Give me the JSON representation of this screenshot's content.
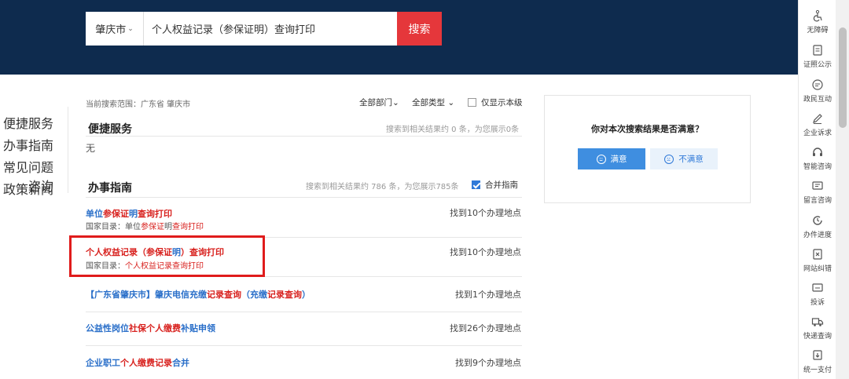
{
  "header": {
    "city": "肇庆市",
    "city_caret": "⌄",
    "search_value": "个人权益记录（参保证明）查询打印",
    "search_button": "搜索"
  },
  "left_nav": [
    "便捷服务",
    "办事指南",
    "常见问题咨询",
    "政策新闻"
  ],
  "scope": "当前搜索范围：广东省 肇庆市",
  "filters": {
    "department": "全部部门",
    "type": "全部类型",
    "caret": "⌄",
    "only_this_level": "仅显示本级"
  },
  "convenience": {
    "title": "便捷服务",
    "note": "搜索到相关结果约 0 条，为您展示0条",
    "empty": "无"
  },
  "guide": {
    "title": "办事指南",
    "note": "搜索到相关结果约 786 条，为您展示785条",
    "merge_label": "合并指南",
    "items": [
      {
        "title": [
          [
            "单位",
            "blue"
          ],
          [
            "参保证",
            "red"
          ],
          [
            "明",
            "blue"
          ],
          [
            "查询打印",
            "red"
          ]
        ],
        "sub_prefix": "国家目录：",
        "sub": [
          [
            "单位",
            ""
          ],
          [
            "参保证",
            "red"
          ],
          [
            "明",
            ""
          ],
          [
            "查询打印",
            "red"
          ]
        ],
        "count": "找到10个办理地点"
      },
      {
        "title": [
          [
            "个人权益记录（参保证",
            "red"
          ],
          [
            "明",
            "blue"
          ],
          [
            "）查询打印",
            "red"
          ]
        ],
        "sub_prefix": "国家目录：",
        "sub": [
          [
            "个人权益记录查询打印",
            "red"
          ]
        ],
        "count": "找到10个办理地点"
      },
      {
        "title": [
          [
            "【广东省肇庆市】肇庆电信充缴",
            "blue"
          ],
          [
            "记录查询",
            "red"
          ],
          [
            "（充缴",
            "blue"
          ],
          [
            "记录查询",
            "red"
          ],
          [
            "）",
            "blue"
          ]
        ],
        "sub_prefix": "",
        "sub": [],
        "count": "找到1个办理地点"
      },
      {
        "title": [
          [
            "公益性岗位",
            "blue"
          ],
          [
            "社保个人缴费",
            "red"
          ],
          [
            "补贴申领",
            "blue"
          ]
        ],
        "sub_prefix": "",
        "sub": [],
        "count": "找到26个办理地点"
      },
      {
        "title": [
          [
            "企业职工",
            "blue"
          ],
          [
            "个人缴费记录",
            "red"
          ],
          [
            "合并",
            "blue"
          ]
        ],
        "sub_prefix": "",
        "sub": [],
        "count": "找到9个办理地点"
      }
    ]
  },
  "satisfaction": {
    "question": "你对本次搜索结果是否满意？",
    "yes": "满意",
    "no": "不满意"
  },
  "rail": [
    {
      "label": "无障碍",
      "icon": "accessibility-icon"
    },
    {
      "label": "证照公示",
      "icon": "clipboard-icon"
    },
    {
      "label": "政民互动",
      "icon": "chat-icon"
    },
    {
      "label": "企业诉求",
      "icon": "pen-icon"
    },
    {
      "label": "智能咨询",
      "icon": "headset-icon"
    },
    {
      "label": "留言咨询",
      "icon": "message-icon"
    },
    {
      "label": "办件进度",
      "icon": "progress-icon"
    },
    {
      "label": "网站纠错",
      "icon": "error-icon"
    },
    {
      "label": "投诉",
      "icon": "complaint-icon"
    },
    {
      "label": "快递查询",
      "icon": "truck-icon"
    },
    {
      "label": "统一支付",
      "icon": "pay-icon"
    }
  ],
  "colors": {
    "header": "#0e2b4e",
    "accent_red": "#e5373b",
    "link_blue": "#2a6fc9",
    "keyword_red": "#d8221f"
  }
}
